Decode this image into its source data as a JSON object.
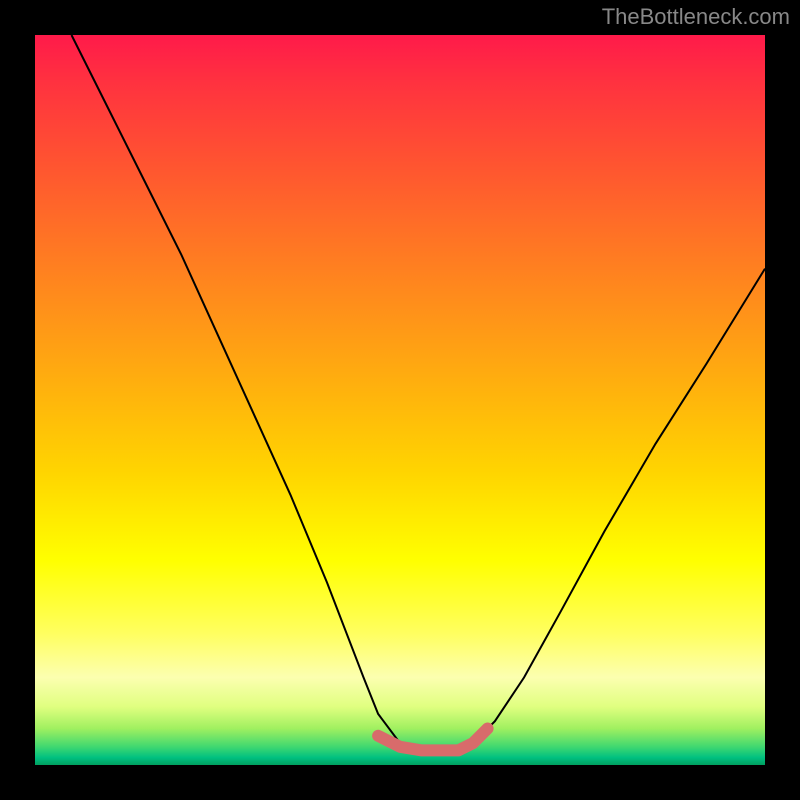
{
  "watermark": "TheBottleneck.com",
  "chart_data": {
    "type": "line",
    "title": "",
    "xlabel": "",
    "ylabel": "",
    "xlim": [
      0,
      100
    ],
    "ylim": [
      0,
      100
    ],
    "series": [
      {
        "name": "curve",
        "x": [
          5,
          10,
          15,
          20,
          25,
          30,
          35,
          40,
          45,
          47,
          50,
          53,
          55,
          58,
          60,
          63,
          67,
          72,
          78,
          85,
          92,
          100
        ],
        "y": [
          100,
          90,
          80,
          70,
          59,
          48,
          37,
          25,
          12,
          7,
          3,
          2,
          2,
          2,
          3,
          6,
          12,
          21,
          32,
          44,
          55,
          68
        ]
      }
    ],
    "highlight": {
      "name": "bottom-segment",
      "x": [
        47,
        50,
        53,
        55,
        58,
        60,
        62
      ],
      "y": [
        4,
        2.5,
        2,
        2,
        2,
        3,
        5
      ],
      "color": "#d86b6b"
    },
    "background_gradient": {
      "top": "#ff1a4a",
      "mid1": "#ffaa10",
      "mid2": "#ffff00",
      "bottom": "#00a060"
    }
  }
}
